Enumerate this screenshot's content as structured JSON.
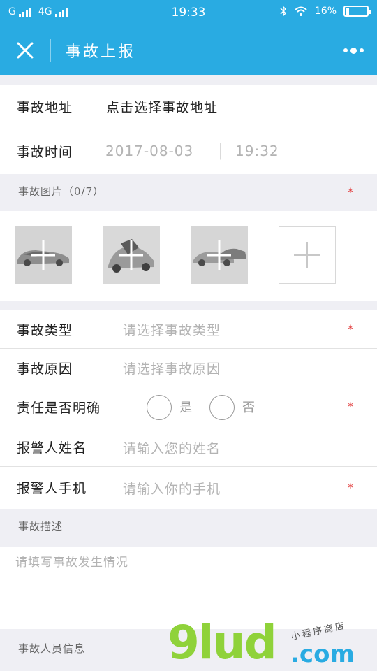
{
  "status_bar": {
    "carrier1": "G",
    "carrier2": "4G",
    "time": "19:33",
    "battery": "16%",
    "battery_level": 0.16
  },
  "title_bar": {
    "title": "事故上报",
    "close_icon": "close-icon",
    "more_icon": "more-icon"
  },
  "form": {
    "address": {
      "label": "事故地址",
      "value": "点击选择事故地址"
    },
    "time": {
      "label": "事故时间",
      "date": "2017-08-03",
      "separator": "|",
      "clock": "19:32"
    },
    "photos": {
      "header": "事故图片（0/7）",
      "required_mark": "*",
      "add_icon": "plus-icon"
    },
    "type": {
      "label": "事故类型",
      "placeholder": "请选择事故类型",
      "required_mark": "*"
    },
    "cause": {
      "label": "事故原因",
      "placeholder": "请选择事故原因"
    },
    "liability": {
      "label": "责任是否明确",
      "option_yes": "是",
      "option_no": "否",
      "required_mark": "*"
    },
    "reporter_name": {
      "label": "报警人姓名",
      "placeholder": "请输入您的姓名"
    },
    "reporter_phone": {
      "label": "报警人手机",
      "placeholder": "请输入你的手机",
      "required_mark": "*"
    },
    "description": {
      "header": "事故描述",
      "placeholder": "请填写事故发生情况"
    },
    "personnel": {
      "header": "事故人员信息"
    }
  },
  "watermark": {
    "main": "9lud",
    "suffix": ".com",
    "tagline": "小程序商店"
  },
  "colors": {
    "brand": "#29abe2",
    "required": "#e23b3b",
    "placeholder": "#b3b3b3"
  }
}
